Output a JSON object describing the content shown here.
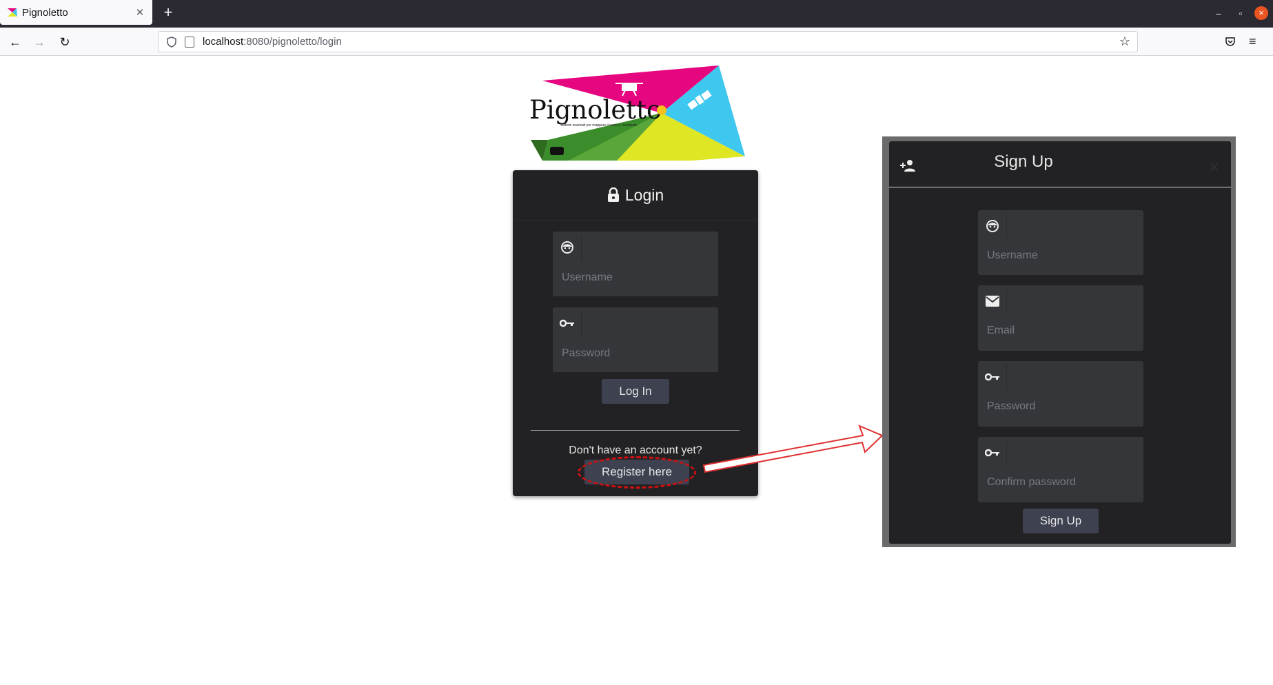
{
  "browser": {
    "tab_title": "Pignoletto",
    "new_tab_symbol": "+",
    "url_host": "localhost",
    "url_rest": ":8080/pignoletto/login",
    "window_controls": [
      "–",
      "▫",
      "×"
    ]
  },
  "logo": {
    "alt_text": "Pignoletto",
    "tagline": "Sistemi avanzati per mappare il suolo e l'ambiente"
  },
  "login": {
    "title": "Login",
    "username_placeholder": "Username",
    "password_placeholder": "Password",
    "login_button": "Log In",
    "no_account_text": "Don't have an account yet?",
    "register_button": "Register here"
  },
  "signup": {
    "title": "Sign Up",
    "close_symbol": "×",
    "username_placeholder": "Username",
    "email_placeholder": "Email",
    "password_placeholder": "Password",
    "confirm_placeholder": "Confirm password",
    "signup_button": "Sign Up"
  },
  "colors": {
    "card_bg": "#222224",
    "field_bg": "#35363a",
    "button_bg": "#3d4150",
    "annotation_red": "#d01010",
    "logo_magenta": "#e6067f",
    "logo_cyan": "#3ec7ef",
    "logo_yellow": "#dfe623"
  },
  "icons": [
    "lock-icon",
    "face-icon",
    "key-icon",
    "email-icon",
    "person-add-icon",
    "close-icon",
    "back-icon",
    "forward-icon",
    "reload-icon",
    "star-icon"
  ]
}
